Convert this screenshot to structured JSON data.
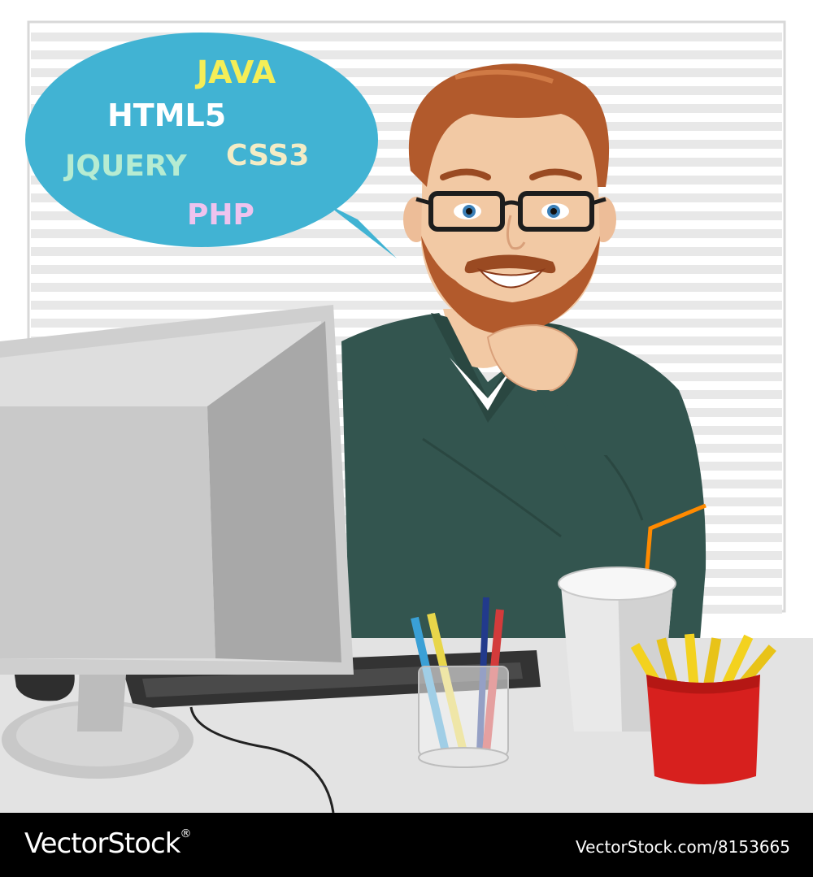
{
  "speech_bubble": {
    "words": [
      {
        "text": "JAVA",
        "color": "#f4ee57"
      },
      {
        "text": "HTML5",
        "color": "#ffffff"
      },
      {
        "text": "JQUERY",
        "color": "#b6ecd2"
      },
      {
        "text": "CSS3",
        "color": "#f3ecc5"
      },
      {
        "text": "PHP",
        "color": "#eec3ee"
      }
    ],
    "bubble_color": "#41b3d3"
  },
  "scene": {
    "background_color": "#ffffff",
    "blinds_color": "#e8e8e8",
    "desk_color": "#e3e3e3",
    "sweater_color": "#33554f",
    "hair_color": "#b25a2c",
    "monitor_color": "#c6c6c6",
    "fries_box_color": "#d7201e"
  },
  "watermark": {
    "brand": "VectorStock",
    "registered": "®",
    "image_id": "VectorStock.com/8153665"
  }
}
